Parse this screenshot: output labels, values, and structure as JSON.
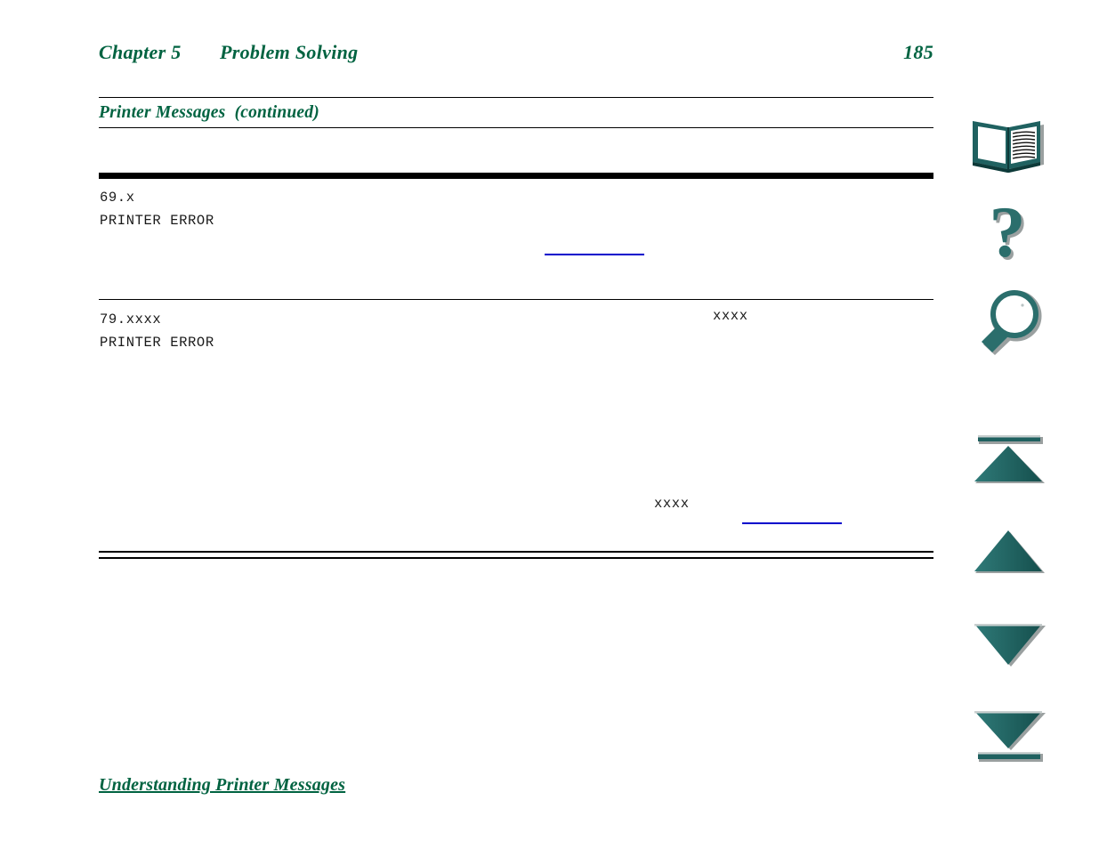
{
  "header": {
    "chapter_label": "Chapter 5",
    "chapter_title": "Problem Solving",
    "page_number": "185"
  },
  "table": {
    "caption": "Printer Messages  (continued)",
    "rows": [
      {
        "code": "69.x",
        "message": "PRINTER ERROR"
      },
      {
        "code": "79.xxxx",
        "message": "PRINTER ERROR"
      }
    ],
    "inline_tokens": [
      {
        "text": "xxxx"
      },
      {
        "text": "xxxx"
      }
    ]
  },
  "footer": {
    "link_label": "Understanding Printer Messages"
  },
  "nav_rail": {
    "items": [
      {
        "name": "book-icon",
        "label": "Contents"
      },
      {
        "name": "question-icon",
        "label": "Help"
      },
      {
        "name": "magnifier-icon",
        "label": "Search"
      },
      {
        "name": "first-page-icon",
        "label": "First Page"
      },
      {
        "name": "previous-page-icon",
        "label": "Previous Page"
      },
      {
        "name": "next-page-icon",
        "label": "Next Page"
      },
      {
        "name": "last-page-icon",
        "label": "Last Page"
      }
    ]
  },
  "colors": {
    "heading_green": "#006341",
    "icon_teal": "#236b6b",
    "link_blue": "#0000cc",
    "rule_black": "#000000"
  }
}
